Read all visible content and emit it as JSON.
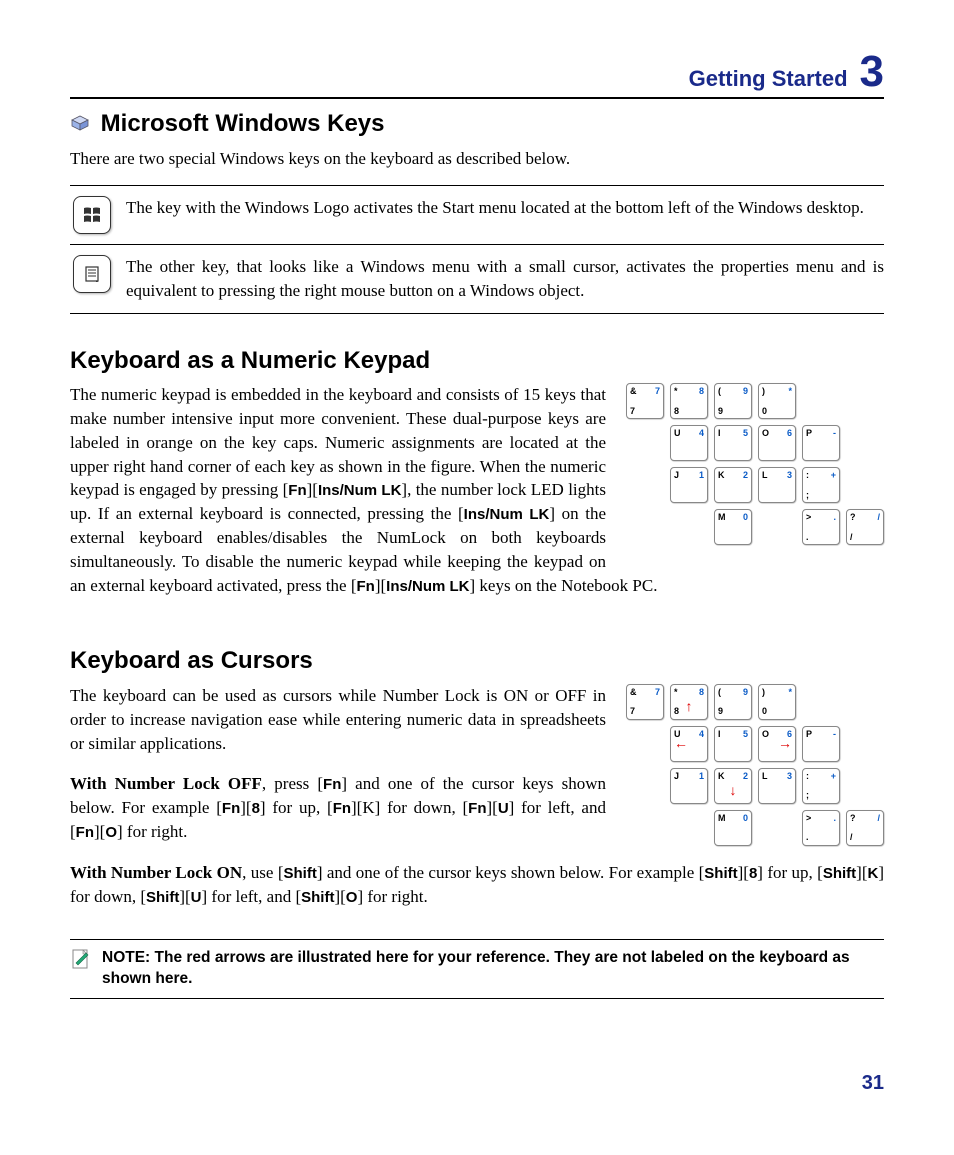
{
  "header": {
    "section": "Getting Started",
    "chapter_number": "3"
  },
  "page_number": "31",
  "sections": {
    "windows_keys": {
      "title": "Microsoft Windows Keys",
      "intro": "There are two special Windows keys on the keyboard as described below.",
      "row1": "The key with the Windows Logo activates the Start menu located at the bottom left of the Windows desktop.",
      "row2": "The other key, that looks like a Windows menu with a small cursor, activates the properties menu and is equivalent to pressing the right mouse button on a Windows object."
    },
    "numeric_keypad": {
      "title": "Keyboard as a Numeric Keypad",
      "body_pre": "The numeric keypad is embedded in the keyboard and consists of 15 keys that make number intensive input more convenient. These dual-purpose keys are labeled in orange on the key caps. Numeric assignments are located at the upper right hand corner of each key as shown in the figure. When the numeric keypad is engaged by pressing [",
      "fn1": "Fn",
      "body_mid1": "][",
      "ins1": "Ins/Num LK",
      "body_mid2": "], the number lock LED lights up. If an external keyboard is connected, pressing the [",
      "ins2": "Ins/Num LK",
      "body_mid3": "] on the external keyboard enables/disables the NumLock on both keyboards simultaneously. To disable the numeric keypad while keeping the keypad on an external keyboard activated, press the  [",
      "fn2": "Fn",
      "body_mid4": "][",
      "ins3": "Ins/Num LK",
      "body_end": "] keys on the Notebook PC."
    },
    "cursors": {
      "title": "Keyboard as Cursors",
      "p1": "The keyboard can be used as cursors while Number Lock is ON or OFF in order to increase navigation ease while entering numeric data in spreadsheets or similar applications.",
      "p2_lead": "With Number Lock OFF",
      "p2_body": ", press [",
      "p2_fn": "Fn",
      "p2_b1": "] and one of the cursor keys shown below. For example [",
      "p2_fn2": "Fn",
      "p2_b2": "][",
      "p2_8": "8",
      "p2_b3": "] for up, [",
      "p2_fn3": "Fn",
      "p2_b4": "][K] for down, [",
      "p2_fn4": "Fn",
      "p2_b5": "][",
      "p2_U": "U",
      "p2_b6": "] for left, and [",
      "p2_fn5": "Fn",
      "p2_b7": "][",
      "p2_O": "O",
      "p2_b8": "] for right.",
      "p3_lead": "With Number Lock ON",
      "p3_body": ", use [",
      "p3_sh": "Shift",
      "p3_b1": "] and one of the cursor keys shown below. For example [",
      "p3_sh2": "Shift",
      "p3_b2": "][",
      "p3_8": "8",
      "p3_b3": "] for up, [",
      "p3_sh3": "Shift",
      "p3_b4": "][",
      "p3_K": "K",
      "p3_b5": "] for down, [",
      "p3_sh4": "Shift",
      "p3_b6": "][",
      "p3_U": "U",
      "p3_b7": "] for left, and [",
      "p3_sh5": "Shift",
      "p3_b8": "][",
      "p3_O": "O",
      "p3_b9": "] for right."
    },
    "note": "NOTE: The red arrows are illustrated here for your reference. They are not labeled on the keyboard as shown here."
  },
  "keypad1": [
    [
      {
        "t": "&",
        "b": "7",
        "n": "7"
      },
      {
        "t": "*",
        "b": "8",
        "n": "8"
      },
      {
        "t": "(",
        "b": "9",
        "n": "9"
      },
      {
        "t": ")",
        "b": "0",
        "n": "*"
      },
      {
        "blank": true
      },
      {
        "blank": true
      }
    ],
    [
      {
        "blank": true
      },
      {
        "t": "U",
        "n": "4"
      },
      {
        "t": "I",
        "n": "5"
      },
      {
        "t": "O",
        "n": "6"
      },
      {
        "t": "P",
        "n": "-"
      },
      {
        "blank": true
      }
    ],
    [
      {
        "blank": true
      },
      {
        "t": "J",
        "n": "1"
      },
      {
        "t": "K",
        "n": "2"
      },
      {
        "t": "L",
        "n": "3"
      },
      {
        "t": ":",
        "b": ";",
        "n": "+"
      },
      {
        "blank": true
      }
    ],
    [
      {
        "blank": true
      },
      {
        "blank": true
      },
      {
        "t": "M",
        "n": "0"
      },
      {
        "blank": true
      },
      {
        "t": ">",
        "b": ".",
        "n": "."
      },
      {
        "t": "?",
        "b": "/",
        "n": "/"
      }
    ]
  ],
  "keypad2": [
    [
      {
        "t": "&",
        "b": "7",
        "n": "7"
      },
      {
        "t": "*",
        "b": "8",
        "n": "8",
        "arrow": "up"
      },
      {
        "t": "(",
        "b": "9",
        "n": "9"
      },
      {
        "t": ")",
        "b": "0",
        "n": "*"
      },
      {
        "blank": true
      },
      {
        "blank": true
      }
    ],
    [
      {
        "blank": true
      },
      {
        "t": "U",
        "n": "4",
        "arrow": "left"
      },
      {
        "t": "I",
        "n": "5"
      },
      {
        "t": "O",
        "n": "6",
        "arrow": "right"
      },
      {
        "t": "P",
        "n": "-"
      },
      {
        "blank": true
      }
    ],
    [
      {
        "blank": true
      },
      {
        "t": "J",
        "n": "1"
      },
      {
        "t": "K",
        "n": "2",
        "arrow": "down"
      },
      {
        "t": "L",
        "n": "3"
      },
      {
        "t": ":",
        "b": ";",
        "n": "+"
      },
      {
        "blank": true
      }
    ],
    [
      {
        "blank": true
      },
      {
        "blank": true
      },
      {
        "t": "M",
        "n": "0"
      },
      {
        "blank": true
      },
      {
        "t": ">",
        "b": ".",
        "n": "."
      },
      {
        "t": "?",
        "b": "/",
        "n": "/"
      }
    ]
  ]
}
